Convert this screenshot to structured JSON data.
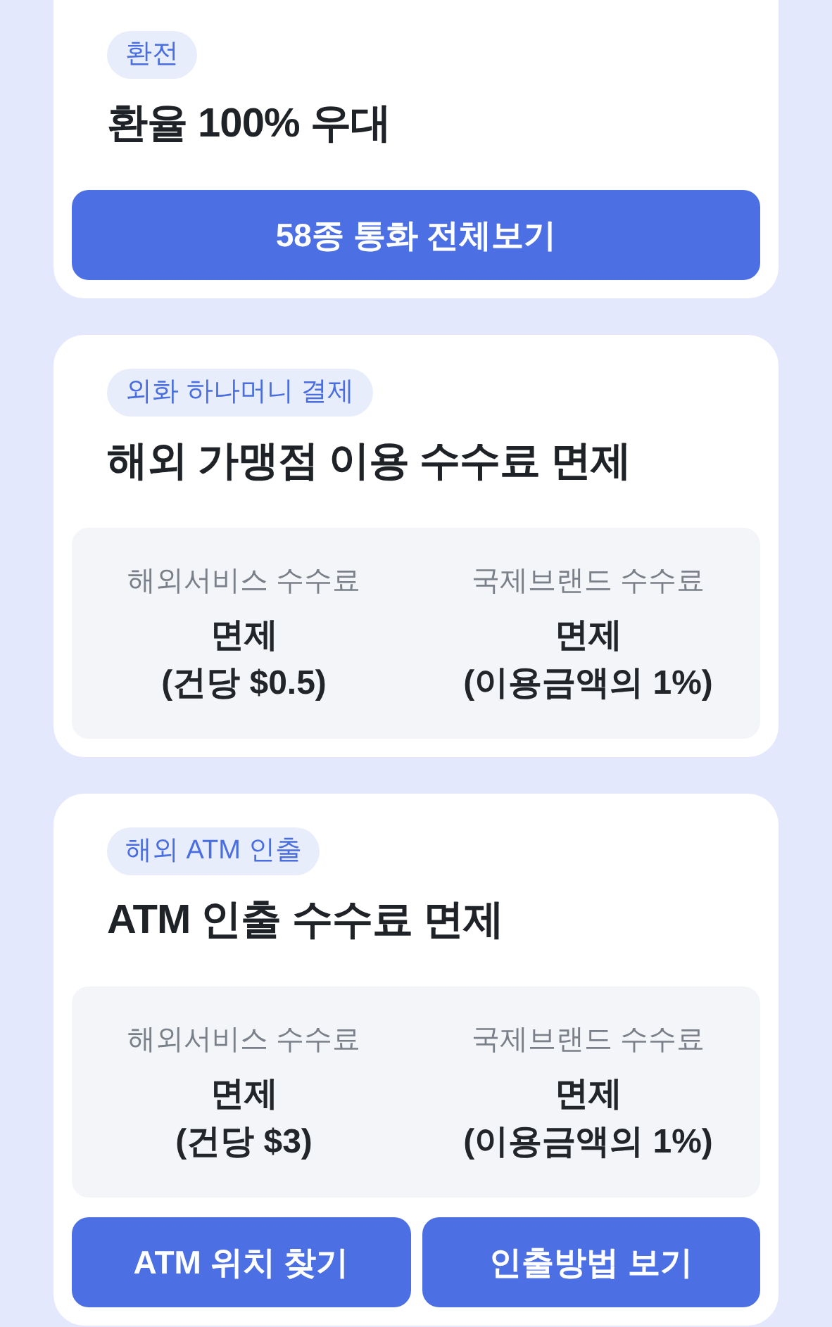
{
  "cards": [
    {
      "tag": "환전",
      "title": "환율 100% 우대",
      "buttons": [
        "58종 통화 전체보기"
      ]
    },
    {
      "tag": "외화 하나머니 결제",
      "title": "해외 가맹점 이용 수수료 면제",
      "fees": [
        {
          "label": "해외서비스 수수료",
          "value": "면제",
          "detail": "(건당 $0.5)"
        },
        {
          "label": "국제브랜드 수수료",
          "value": "면제",
          "detail": "(이용금액의 1%)"
        }
      ]
    },
    {
      "tag": "해외 ATM 인출",
      "title": "ATM 인출 수수료 면제",
      "fees": [
        {
          "label": "해외서비스 수수료",
          "value": "면제",
          "detail": "(건당 $3)"
        },
        {
          "label": "국제브랜드 수수료",
          "value": "면제",
          "detail": "(이용금액의 1%)"
        }
      ],
      "buttons": [
        "ATM 위치 찾기",
        "인출방법 보기"
      ]
    }
  ]
}
